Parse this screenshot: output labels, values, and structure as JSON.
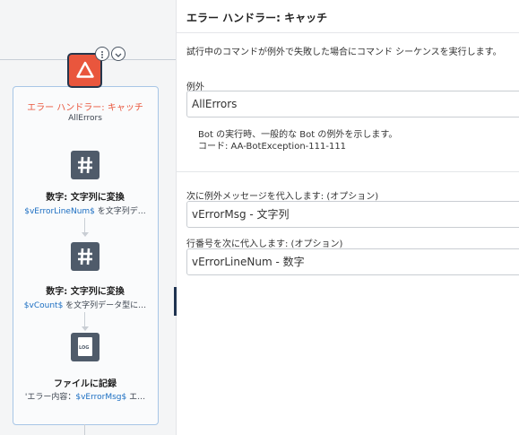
{
  "flow": {
    "catch_node": {
      "title": "エラー ハンドラー: キャッチ",
      "subtitle": "AllErrors"
    },
    "node1": {
      "title": "数字: 文字列に変換",
      "var": "$vErrorLineNum$",
      "rest": " を文字列デ…"
    },
    "node2": {
      "title": "数字: 文字列に変換",
      "var": "$vCount$",
      "rest": " を文字列データ型に…"
    },
    "node3": {
      "title": "ファイルに記録",
      "prefix": "'エラー内容：",
      "var": "$vErrorMsg$",
      "rest": " エ…"
    }
  },
  "panel": {
    "title": "エラー ハンドラー: キャッチ",
    "description": "試行中のコマンドが例外で失敗した場合にコマンド シーケンスを実行します。",
    "exception_label": "例外",
    "exception_value": "AllErrors",
    "info_line1": "Bot の実行時、一般的な Bot の例外を示します。",
    "info_line2": "コード: AA-BotException-111-111",
    "msg_label": "次に例外メッセージを代入します: (オプション)",
    "msg_value": "vErrorMsg - 文字列",
    "line_label": "行番号を次に代入します: (オプション)",
    "line_value": "vErrorLineNum - 数字"
  },
  "colors": {
    "catch_accent": "#e9563d",
    "variable_blue": "#1b6ec2",
    "icon_gray": "#4f5b6a"
  }
}
